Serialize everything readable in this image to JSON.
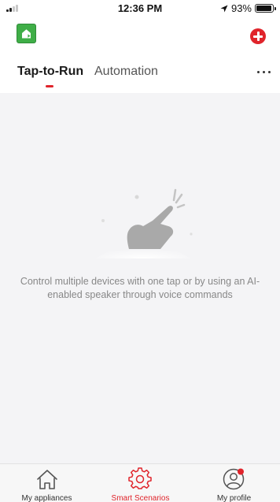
{
  "status_bar": {
    "time": "12:36 PM",
    "battery": "93%",
    "battery_level": 0.93,
    "location_icon": "location-arrow-icon",
    "signal_icon": "cellular-signal-icon"
  },
  "header": {
    "logo_icon": "home-logo-icon",
    "add_icon": "add-plus-icon",
    "more_icon": "more-dots-icon"
  },
  "tabs": [
    {
      "label": "Tap-to-Run",
      "active": true
    },
    {
      "label": "Automation",
      "active": false
    }
  ],
  "empty_state": {
    "icon": "tap-hand-icon",
    "message": "Control multiple devices with one tap or by using an AI-enabled speaker through voice commands"
  },
  "bottom_nav": {
    "items": [
      {
        "label": "My appliances",
        "icon": "house-icon",
        "active": false
      },
      {
        "label": "Smart Scenarios",
        "icon": "gear-icon",
        "active": true
      },
      {
        "label": "My profile",
        "icon": "profile-icon",
        "active": false
      }
    ]
  },
  "colors": {
    "accent": "#e0242b",
    "logo": "#3fae47",
    "background": "#f4f4f6"
  }
}
